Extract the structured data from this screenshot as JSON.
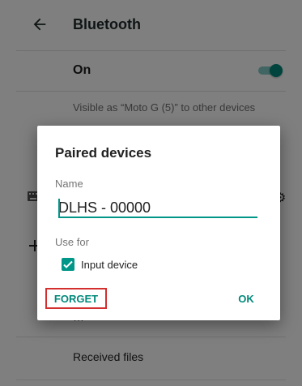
{
  "appbar": {
    "title": "Bluetooth"
  },
  "bluetooth_toggle": {
    "label": "On",
    "state": "on"
  },
  "visibility": {
    "text": "Visible as “Moto G (5)” to other devices"
  },
  "background_rows": {
    "partial_item": "…",
    "received_files": "Received files"
  },
  "dialog": {
    "title": "Paired devices",
    "name_label": "Name",
    "name_value": "DLHS - 00000",
    "use_for_label": "Use for",
    "input_device": {
      "label": "Input device",
      "checked": true
    },
    "forget_button": "FORGET",
    "ok_button": "OK"
  },
  "colors": {
    "accent": "#009688",
    "highlight_box": "#d32f2f"
  }
}
